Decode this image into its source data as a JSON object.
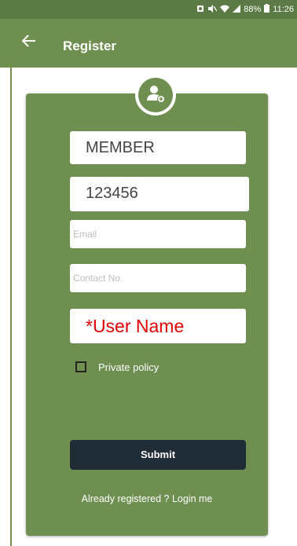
{
  "status_bar": {
    "battery": "88%",
    "time": "11:26"
  },
  "appbar": {
    "back_icon": "arrow-left-icon",
    "title": "Register"
  },
  "avatar": {
    "icon": "add-user-icon"
  },
  "form": {
    "member_value": "MEMBER",
    "code_value": "123456",
    "email_placeholder": "Email",
    "contact_placeholder": "Contact No.",
    "username_error": "*User Name",
    "checkbox_label": "Private policy",
    "checkbox_checked": false,
    "submit_label": "Submit",
    "login_link": "Already registered ? Login me"
  },
  "colors": {
    "statusbar": "#5c7a45",
    "primary": "#6f8f50",
    "submit": "#1f2c35",
    "error": "#e00000"
  }
}
